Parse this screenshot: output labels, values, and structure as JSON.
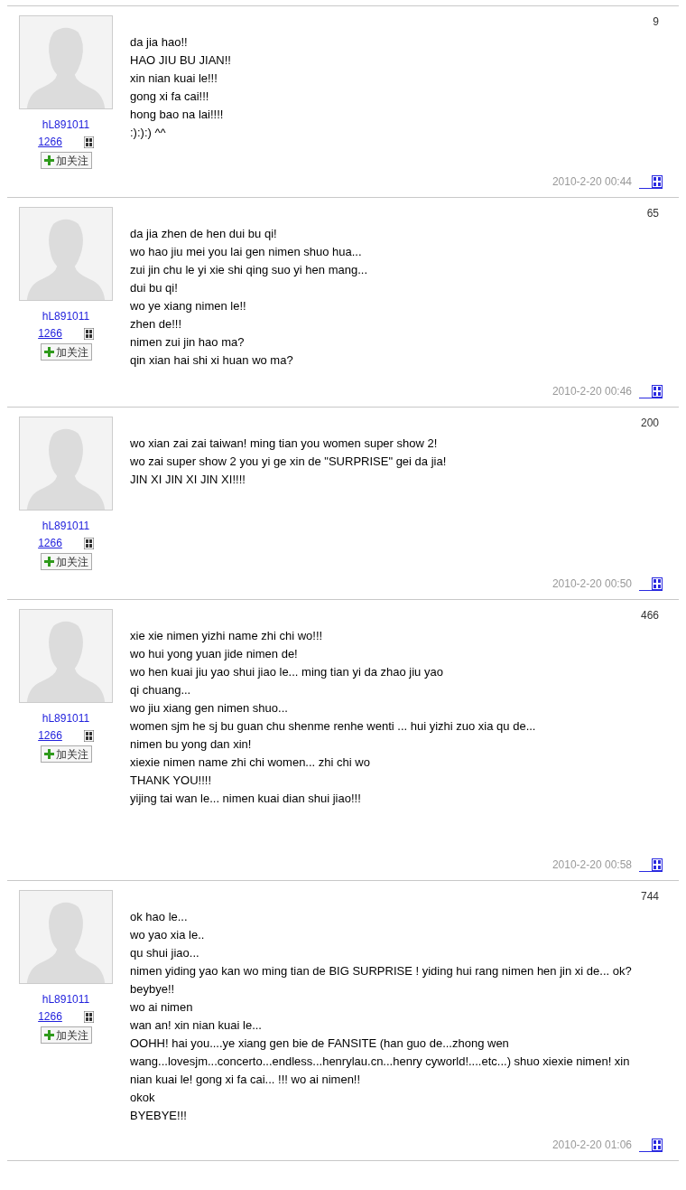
{
  "posts": [
    {
      "user": "hL891011",
      "count": "1266",
      "follow": "加关注",
      "floor": "9",
      "lines": [
        "da jia hao!!",
        "HAO JIU BU JIAN!!",
        "xin nian kuai le!!!",
        "gong xi fa cai!!!",
        "hong bao na lai!!!!",
        ":):):) ^^"
      ],
      "time": "2010-2-20 00:44"
    },
    {
      "user": "hL891011",
      "count": "1266",
      "follow": "加关注",
      "floor": "65",
      "lines": [
        "da jia zhen de hen dui bu qi!",
        "wo hao jiu mei you lai gen nimen shuo hua...",
        "zui jin chu le yi xie shi qing suo yi hen mang...",
        "dui bu qi!",
        "wo ye xiang nimen le!!",
        "zhen de!!!",
        "nimen zui jin hao ma?",
        "qin xian hai shi xi huan wo ma?"
      ],
      "time": "2010-2-20 00:46"
    },
    {
      "user": "hL891011",
      "count": "1266",
      "follow": "加关注",
      "floor": "200",
      "lines": [
        "wo xian zai zai taiwan! ming tian you women super show 2!",
        "wo zai super show 2 you yi ge xin de \"SURPRISE\" gei da jia!",
        "JIN XI JIN XI JIN XI!!!!"
      ],
      "time": "2010-2-20 00:50"
    },
    {
      "user": "hL891011",
      "count": "1266",
      "follow": "加关注",
      "floor": "466",
      "lines": [
        "xie xie nimen yizhi name zhi chi wo!!!",
        "wo hui yong yuan jide nimen de!",
        "wo hen kuai jiu yao shui jiao le... ming tian yi da zhao jiu yao",
        "qi chuang...",
        "wo jiu xiang gen nimen shuo...",
        "women sjm he sj bu guan chu shenme renhe wenti ... hui yizhi zuo xia qu de...",
        "nimen bu yong dan xin!",
        "xiexie nimen name zhi chi women... zhi chi wo",
        "THANK YOU!!!!",
        "yijing tai wan le... nimen kuai dian shui jiao!!!"
      ],
      "time": "2010-2-20 00:58"
    },
    {
      "user": "hL891011",
      "count": "1266",
      "follow": "加关注",
      "floor": "744",
      "lines": [
        "ok hao le...",
        "wo yao xia le..",
        "qu shui jiao...",
        "nimen yiding yao kan wo ming tian de BIG SURPRISE ! yiding hui rang nimen hen jin xi de... ok?",
        "beybye!!",
        "wo ai nimen",
        "wan an! xin nian kuai le...",
        "OOHH! hai you....ye xiang gen bie de FANSITE (han guo de...zhong wen",
        "wang...lovesjm...concerto...endless...henrylau.cn...henry cyworld!....etc...) shuo xiexie nimen! xin",
        "nian kuai le! gong xi fa cai... !!! wo ai nimen!!",
        "okok",
        "BYEBYE!!!"
      ],
      "time": "2010-2-20 01:06"
    }
  ]
}
